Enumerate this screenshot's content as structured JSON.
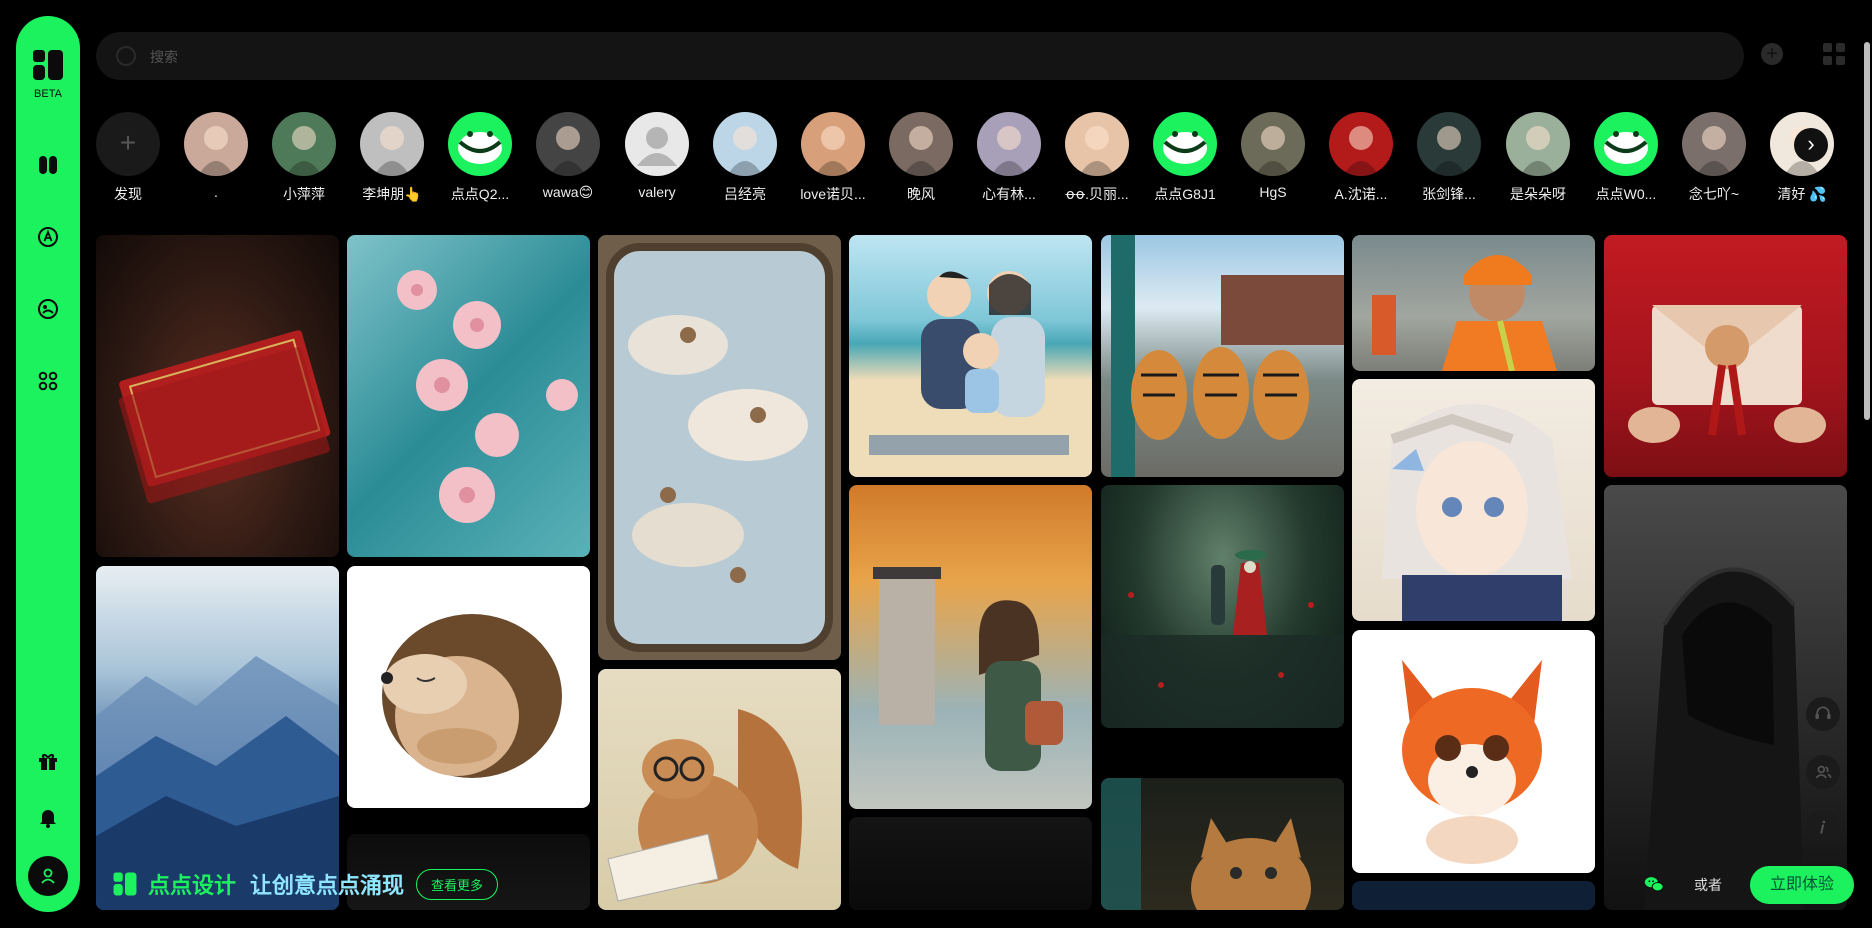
{
  "app": {
    "beta_label": "BETA",
    "accent": "#1cf15e"
  },
  "search": {
    "placeholder": "搜索"
  },
  "stories": {
    "add_label": "发现",
    "items": [
      {
        "name": ".",
        "color": "#caa89a"
      },
      {
        "name": "小萍萍",
        "color": "#4f7a59"
      },
      {
        "name": "李坤朋👆",
        "color": "#bfbfbf"
      },
      {
        "name": "点点Q2...",
        "color": "#1cf15e",
        "icon": "smile-avatar"
      },
      {
        "name": "wawa😊",
        "color": "#444"
      },
      {
        "name": "valery",
        "color": "#e8e8e8",
        "icon": "default-user"
      },
      {
        "name": "吕经亮",
        "color": "#bcd6e8"
      },
      {
        "name": "love诺贝...",
        "color": "#d8a07a"
      },
      {
        "name": "晚风",
        "color": "#7a6a62"
      },
      {
        "name": "心有林...",
        "color": "#a8a0b8"
      },
      {
        "name": "ꝋꝋ.贝丽...",
        "color": "#e7c3a7"
      },
      {
        "name": "点点G8J1",
        "color": "#1cf15e",
        "icon": "smile-avatar"
      },
      {
        "name": "HgS",
        "color": "#6c6a58"
      },
      {
        "name": "A.沈诺...",
        "color": "#b31b1b"
      },
      {
        "name": "张剑锋...",
        "color": "#2a3a38"
      },
      {
        "name": "是朵朵呀",
        "color": "#9ab09a"
      },
      {
        "name": "点点W0...",
        "color": "#1cf15e",
        "icon": "smile-avatar"
      },
      {
        "name": "念七吖~",
        "color": "#7a6f6a"
      },
      {
        "name": "清好 💦",
        "color": "#f0e8dc"
      }
    ]
  },
  "banner": {
    "brand": "点点设计",
    "slogan": "让创意点点涌现",
    "more_label": "查看更多",
    "or_label": "或者",
    "cta_label": "立即体验"
  }
}
